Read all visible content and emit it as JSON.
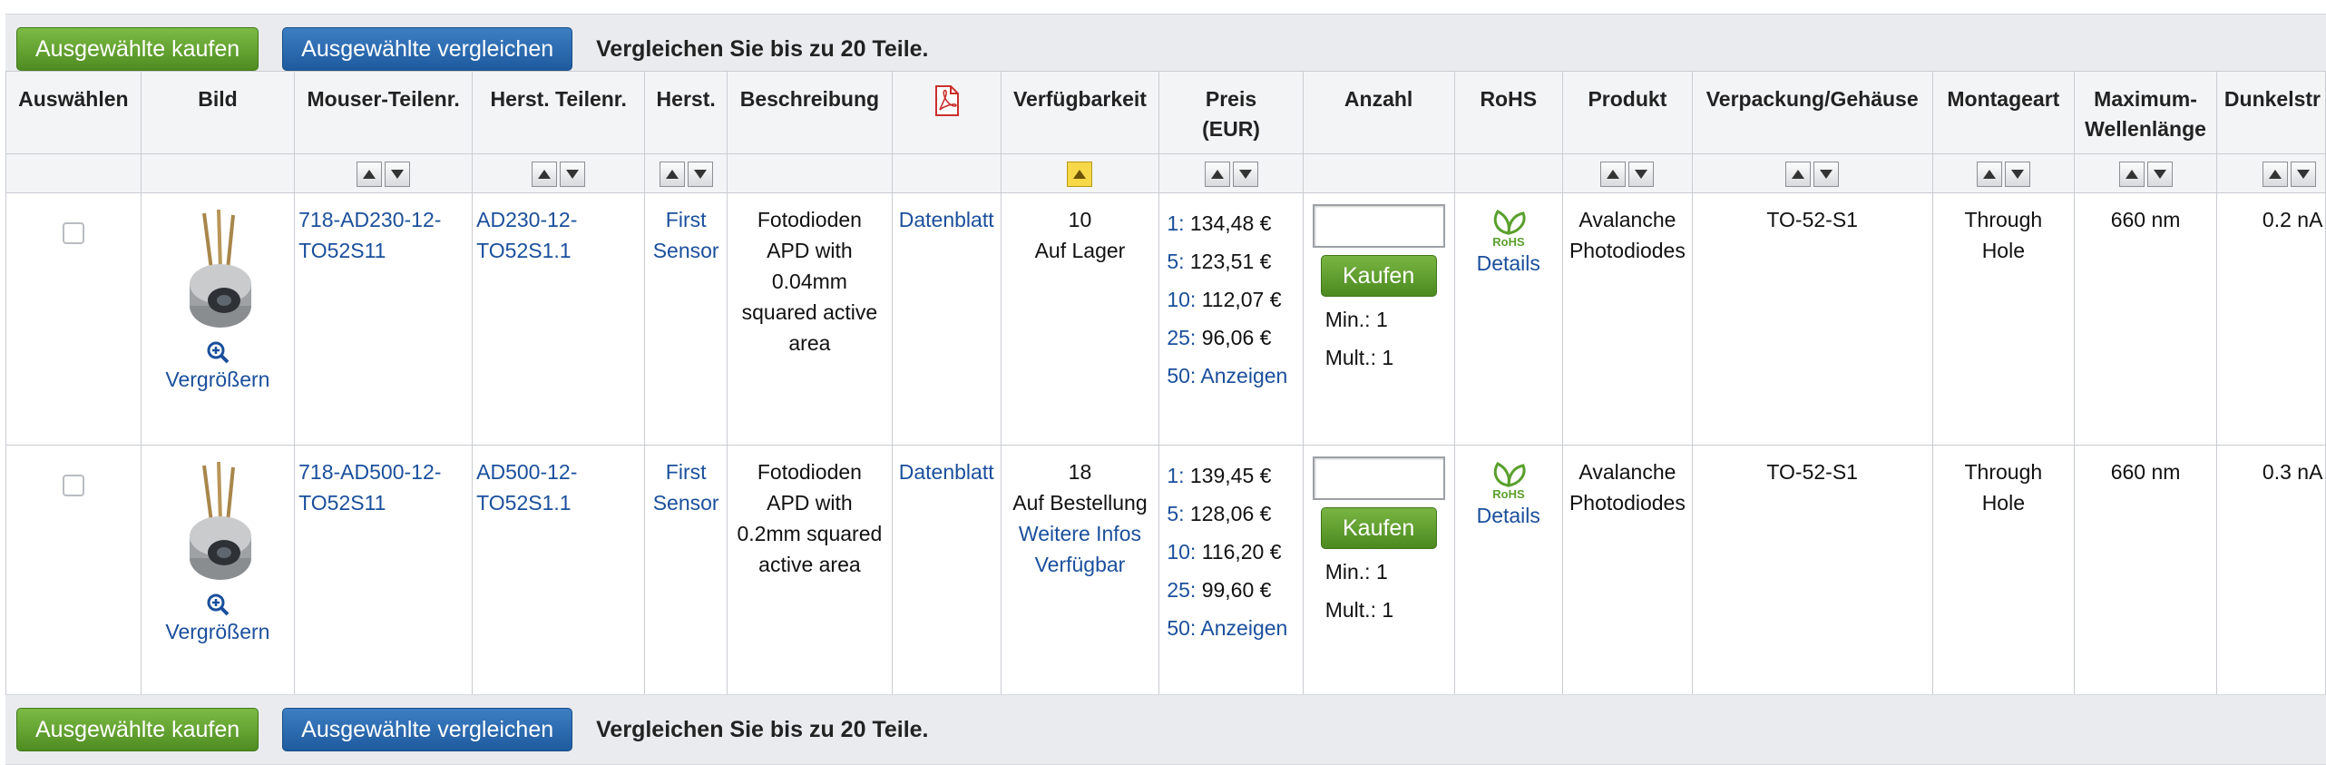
{
  "toolbar": {
    "buy_selected": "Ausgewählte kaufen",
    "compare_selected": "Ausgewählte vergleichen",
    "compare_note": "Vergleichen Sie bis zu 20 Teile."
  },
  "columns": {
    "select": "Auswählen",
    "image": "Bild",
    "mouser_part": "Mouser-Teilenr.",
    "mfr_part": "Herst. Teilenr.",
    "mfr": "Herst.",
    "description": "Beschreibung",
    "datasheet_icon": "pdf-icon",
    "availability": "Verfügbarkeit",
    "price_line1": "Preis",
    "price_line2": "(EUR)",
    "quantity": "Anzahl",
    "rohs": "RoHS",
    "product": "Produkt",
    "package": "Verpackung/Gehäuse",
    "mounting": "Montageart",
    "max_wavelength_line1": "Maximum-",
    "max_wavelength_line2": "Wellenlänge",
    "dark_current": "Dunkelstr"
  },
  "rows": [
    {
      "enlarge_label": "Vergrößern",
      "mouser_part_line1": "718-AD230-12-",
      "mouser_part_line2": "TO52S11",
      "mfr_part_line1": "AD230-12-",
      "mfr_part_line2": "TO52S1.1",
      "mfr_line1": "First",
      "mfr_line2": "Sensor",
      "desc_lines": [
        "Fotodioden",
        "APD with",
        "0.04mm",
        "squared active",
        "area"
      ],
      "datasheet": "Datenblatt",
      "stock_count": "10",
      "stock_status": "Auf Lager",
      "more_info_line1": "",
      "more_info_line2": "",
      "price_breaks": [
        {
          "qty": "1",
          "price": "134,48 €"
        },
        {
          "qty": "5",
          "price": "123,51 €"
        },
        {
          "qty": "10",
          "price": "112,07 €"
        },
        {
          "qty": "25",
          "price": "96,06 €"
        },
        {
          "qty": "50",
          "price": "Anzeigen"
        }
      ],
      "buy_label": "Kaufen",
      "min_label": "Min.: 1",
      "mult_label": "Mult.: 1",
      "rohs_details": "Details",
      "product_line1": "Avalanche",
      "product_line2": "Photodiodes",
      "package": "TO-52-S1",
      "mounting_line1": "Through",
      "mounting_line2": "Hole",
      "max_wavelength": "660 nm",
      "dark_current": "0.2 nA"
    },
    {
      "enlarge_label": "Vergrößern",
      "mouser_part_line1": "718-AD500-12-",
      "mouser_part_line2": "TO52S11",
      "mfr_part_line1": "AD500-12-",
      "mfr_part_line2": "TO52S1.1",
      "mfr_line1": "First",
      "mfr_line2": "Sensor",
      "desc_lines": [
        "Fotodioden",
        "APD with",
        "0.2mm squared",
        "active area",
        ""
      ],
      "datasheet": "Datenblatt",
      "stock_count": "18",
      "stock_status": "Auf Bestellung",
      "more_info_line1": "Weitere Infos",
      "more_info_line2": "Verfügbar",
      "price_breaks": [
        {
          "qty": "1",
          "price": "139,45 €"
        },
        {
          "qty": "5",
          "price": "128,06 €"
        },
        {
          "qty": "10",
          "price": "116,20 €"
        },
        {
          "qty": "25",
          "price": "99,60 €"
        },
        {
          "qty": "50",
          "price": "Anzeigen"
        }
      ],
      "buy_label": "Kaufen",
      "min_label": "Min.: 1",
      "mult_label": "Mult.: 1",
      "rohs_details": "Details",
      "product_line1": "Avalanche",
      "product_line2": "Photodiodes",
      "package": "TO-52-S1",
      "mounting_line1": "Through",
      "mounting_line2": "Hole",
      "max_wavelength": "660 nm",
      "dark_current": "0.3 nA"
    }
  ],
  "rohs_logo_text": "RoHS",
  "colors": {
    "link": "#1a4f9c",
    "green_button": "#5a9a2a",
    "blue_button": "#2a66a8",
    "sort_active": "#f6d848",
    "rohs_green": "#5aa02c"
  }
}
